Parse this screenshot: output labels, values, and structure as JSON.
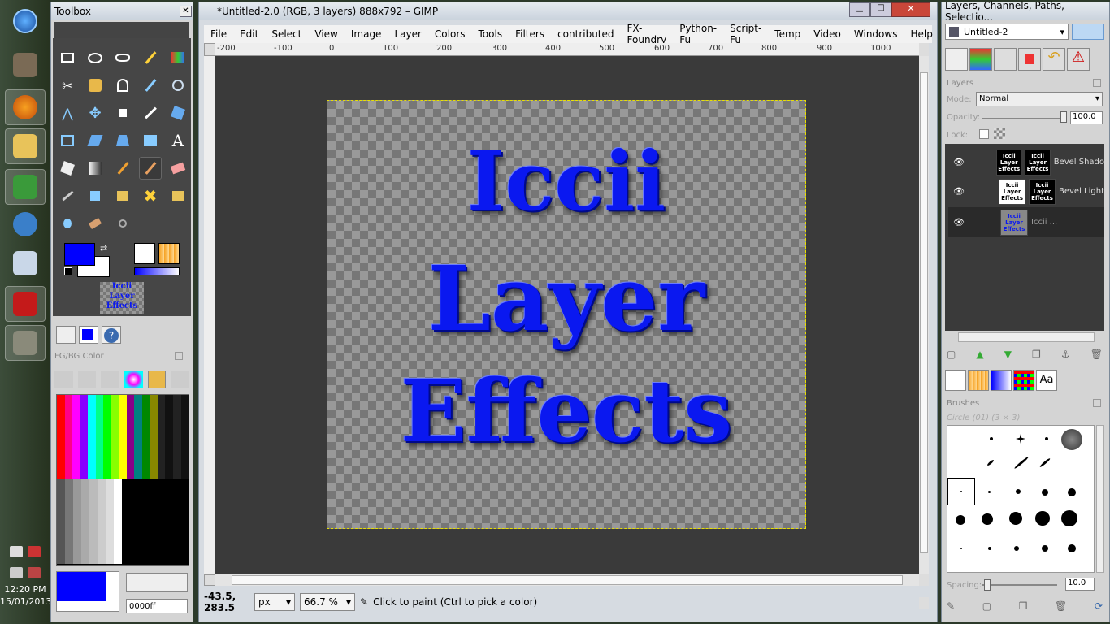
{
  "taskbar": {
    "apps": [
      {
        "icon": "windows-start-icon"
      },
      {
        "icon": "gimp-icon"
      },
      {
        "icon": "firefox-icon"
      },
      {
        "icon": "file-explorer-icon"
      },
      {
        "icon": "editor-icon"
      },
      {
        "icon": "thunderbird-icon"
      },
      {
        "icon": "monitor-icon"
      },
      {
        "icon": "acrobat-icon"
      },
      {
        "icon": "gimp-active-icon"
      }
    ],
    "time": "12:20 PM",
    "date": "15/01/2013"
  },
  "toolbox": {
    "title": "Toolbox",
    "fgbg_title": "FG/BG Color",
    "fg_color": "#0000ff",
    "bg_color": "#ffffff",
    "hex_value": "0000ff",
    "preview_lines": [
      "Iccii",
      "Layer",
      "Effects"
    ]
  },
  "main": {
    "title": "*Untitled-2.0 (RGB, 3 layers) 888x792 – GIMP",
    "menu": [
      "File",
      "Edit",
      "Select",
      "View",
      "Image",
      "Layer",
      "Colors",
      "Tools",
      "Filters",
      "contributed",
      "FX-Foundry",
      "Python-Fu",
      "Script-Fu",
      "Temp",
      "Video",
      "Windows",
      "Help"
    ],
    "ruler_ticks": [
      "-200",
      "-100",
      "0",
      "100",
      "200",
      "300",
      "400",
      "500",
      "600",
      "700",
      "800",
      "900",
      "1000"
    ],
    "canvas_lines": [
      "Iccii",
      "Layer",
      "Effects"
    ],
    "status": {
      "coords": "-43.5, 283.5",
      "unit": "px",
      "zoom": "66.7 %",
      "message": "Click to paint (Ctrl to pick a color)"
    }
  },
  "dock": {
    "title": "Layers, Channels, Paths, Selectio...",
    "image_select": "Untitled-2",
    "layers_label": "Layers",
    "mode_label": "Mode:",
    "mode_value": "Normal",
    "opacity_label": "Opacity:",
    "opacity_value": "100.0",
    "lock_label": "Lock:",
    "layers": [
      {
        "name": "Bevel Shado",
        "thumb": "Iccii Layer Effects",
        "mask": "Iccii Layer Effects"
      },
      {
        "name": "Bevel Light",
        "thumb": "Iccii Layer Effects",
        "mask": "Iccii Layer Effects"
      },
      {
        "name": "Iccii ...",
        "thumb": "Iccii Layer Effects"
      }
    ],
    "brushes_label": "Brushes",
    "brush_name": "Circle (01) (3 × 3)",
    "spacing_label": "Spacing:",
    "spacing_value": "10.0",
    "font_tab": "Aa"
  }
}
